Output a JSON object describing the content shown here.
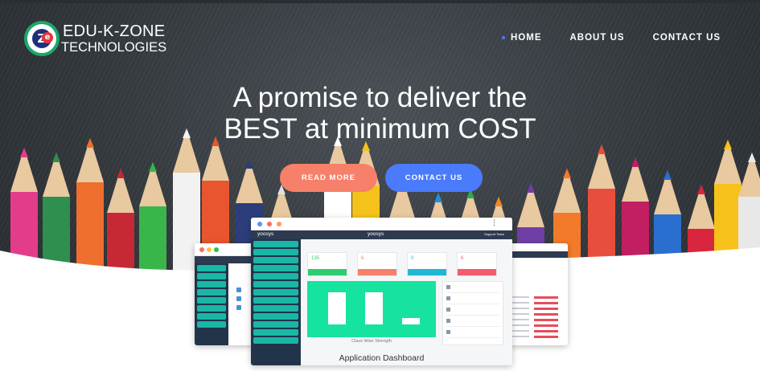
{
  "brand": {
    "name_line1": "EDU-K-ZONE",
    "name_line2": "TECHNOLOGIES",
    "badge_letter": "Z",
    "badge_sub": "e",
    "accent_green": "#1aa86b",
    "accent_navy": "#1f2f7a",
    "accent_red": "#e4343c"
  },
  "nav": {
    "items": [
      {
        "label": "HOME",
        "active": true
      },
      {
        "label": "ABOUT US",
        "active": false
      },
      {
        "label": "CONTACT US",
        "active": false
      }
    ],
    "active_dot_color": "#4a7bff"
  },
  "hero": {
    "headline_line1": "A promise to deliver the",
    "headline_line2": "BEST at minimum COST",
    "primary_button": "READ MORE",
    "secondary_button": "CONTACT US",
    "primary_color": "#f6806a",
    "secondary_color": "#4a7bfb"
  },
  "dashboard_preview": {
    "app_logo": "yoosys",
    "app_title": "yoosys",
    "user_menu": "Support Team",
    "stats": [
      {
        "value": "135",
        "color": "#2ecc71"
      },
      {
        "value": "6",
        "color": "#f6806a"
      },
      {
        "value": "0",
        "color": "#1fb8d3"
      },
      {
        "value": "6",
        "color": "#f35b6e"
      }
    ],
    "chart_caption": "Class Wise Strength",
    "caption": "Application Dashboard"
  }
}
